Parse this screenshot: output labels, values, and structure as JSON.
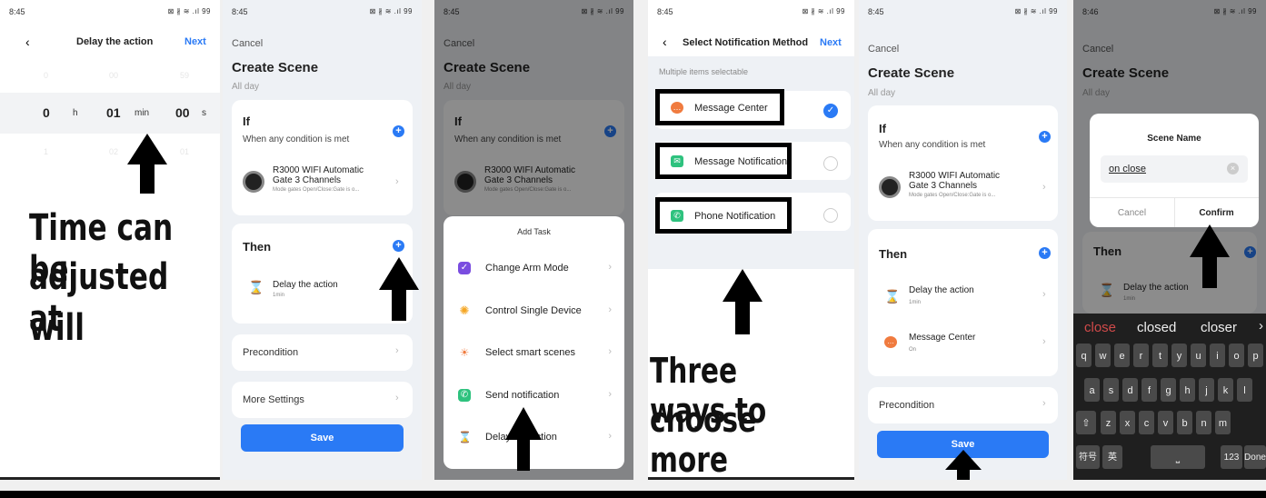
{
  "s1": {
    "time": "8:45",
    "signal": "⊠ ∦ ≋ .ıl 99",
    "title": "Delay the action",
    "next": "Next",
    "ghost_top": [
      "0",
      "00",
      "59"
    ],
    "hours": "0",
    "h": "h",
    "mins": "01",
    "min": "min",
    "secs": "00",
    "s": "s",
    "ghost_bot": [
      "1",
      "02",
      "01"
    ],
    "caption": [
      "Time can be",
      "adjusted at",
      "will"
    ]
  },
  "s2": {
    "time": "8:45",
    "signal": "⊠ ∦ ≋ .ıl 99",
    "cancel": "Cancel",
    "title": "Create Scene",
    "allday": "All day",
    "if": "If",
    "cond": "When any condition is met",
    "device": "R3000 WIFI Automatic",
    "device2": "Gate 3 Channels",
    "devsub": "Mode gates Open/Close:Gate is o...",
    "then": "Then",
    "action": "Delay the action",
    "actsub": "1min",
    "pre": "Precondition",
    "more": "More Settings",
    "save": "Save"
  },
  "s3": {
    "time": "8:45",
    "signal": "⊠ ∦ ≋ .ıl 99",
    "cancel": "Cancel",
    "title": "Create Scene",
    "allday": "All day",
    "if": "If",
    "cond": "When any condition is met",
    "device": "R3000 WIFI Automatic",
    "device2": "Gate 3 Channels",
    "devsub": "Mode gates Open/Close:Gate is o...",
    "sheet_title": "Add Task",
    "tasks": [
      "Change Arm Mode",
      "Control Single Device",
      "Select smart scenes",
      "Send notification",
      "Delay the action"
    ]
  },
  "s4": {
    "time": "8:45",
    "signal": "⊠ ∦ ≋ .ıl 99",
    "title": "Select Notification Method",
    "next": "Next",
    "hint": "Multiple items selectable",
    "methods": [
      "Message Center",
      "Message Notification",
      "Phone Notification"
    ],
    "caption": [
      "Three ways to",
      "choose more"
    ]
  },
  "s5": {
    "time": "8:45",
    "signal": "⊠ ∦ ≋ .ıl 99",
    "cancel": "Cancel",
    "title": "Create Scene",
    "allday": "All day",
    "if": "If",
    "cond": "When any condition is met",
    "device": "R3000 WIFI Automatic",
    "device2": "Gate 3 Channels",
    "devsub": "Mode gates Open/Close:Gate is o...",
    "then": "Then",
    "action": "Delay the action",
    "actsub": "1min",
    "action2": "Message Center",
    "act2sub": "On",
    "pre": "Precondition",
    "save": "Save"
  },
  "s6": {
    "time": "8:46",
    "signal": "⊠ ∦ ≋ .ıl 99",
    "cancel": "Cancel",
    "title": "Create Scene",
    "allday": "All day",
    "dialog_title": "Scene Name",
    "input": "on close",
    "dcancel": "Cancel",
    "dconfirm": "Confirm",
    "then": "Then",
    "action": "Delay the action",
    "actsub": "1min",
    "suggestions": [
      "close",
      "closed",
      "closer"
    ],
    "row1": [
      "q",
      "w",
      "e",
      "r",
      "t",
      "y",
      "u",
      "i",
      "o",
      "p"
    ],
    "row2": [
      "a",
      "s",
      "d",
      "f",
      "g",
      "h",
      "j",
      "k",
      "l"
    ],
    "row3": [
      "z",
      "x",
      "c",
      "v",
      "b",
      "n",
      "m"
    ],
    "sym": "符号",
    "lang": "英",
    "num": "123",
    "done": "Done"
  },
  "colors": {
    "accent": "#2a7af5"
  }
}
